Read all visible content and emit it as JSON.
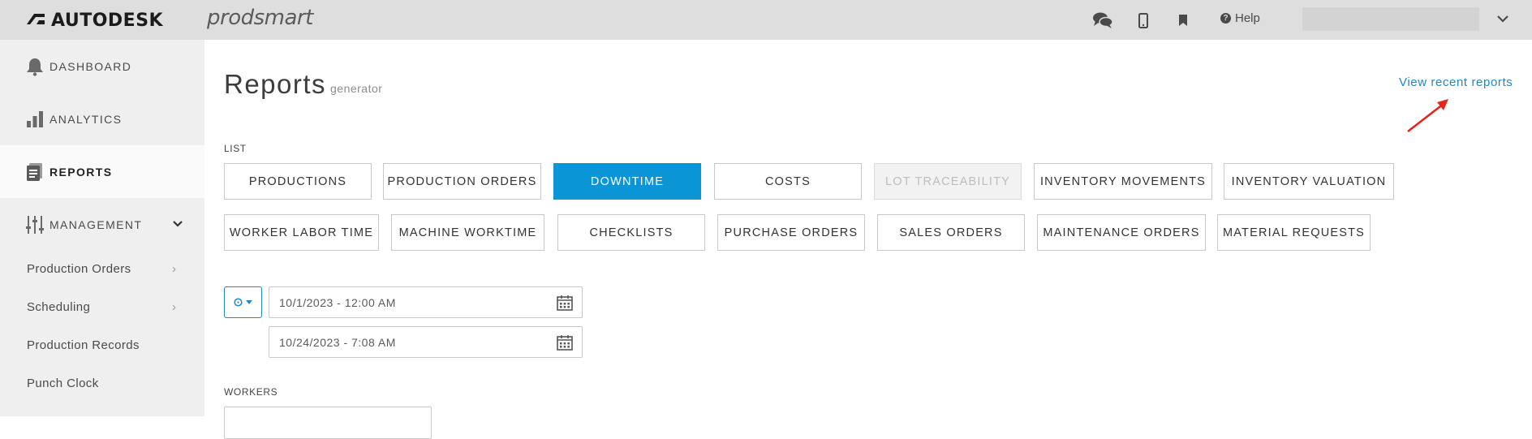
{
  "brand": {
    "name": "AUTODESK",
    "product": "prodsmart"
  },
  "topbar": {
    "help_label": "Help"
  },
  "sidebar": {
    "items": [
      {
        "label": "DASHBOARD",
        "icon": "bell-icon"
      },
      {
        "label": "ANALYTICS",
        "icon": "bar-chart-icon"
      },
      {
        "label": "REPORTS",
        "icon": "report-icon",
        "active": true
      },
      {
        "label": "MANAGEMENT",
        "icon": "sliders-icon"
      }
    ],
    "subitems": [
      {
        "label": "Production Orders"
      },
      {
        "label": "Scheduling"
      },
      {
        "label": "Production Records"
      },
      {
        "label": "Punch Clock"
      }
    ]
  },
  "main": {
    "title": "Reports",
    "subtitle": "generator",
    "recent_link": "View recent reports",
    "list_label": "LIST",
    "report_row1": [
      "PRODUCTIONS",
      "PRODUCTION ORDERS",
      "DOWNTIME",
      "COSTS",
      "LOT TRACEABILITY",
      "INVENTORY MOVEMENTS",
      "INVENTORY VALUATION"
    ],
    "report_row2": [
      "WORKER LABOR TIME",
      "MACHINE WORKTIME",
      "CHECKLISTS",
      "PURCHASE ORDERS",
      "SALES ORDERS",
      "MAINTENANCE ORDERS",
      "MATERIAL REQUESTS"
    ],
    "selected_report": "DOWNTIME",
    "disabled_report": "LOT TRACEABILITY",
    "date_from": "10/1/2023 - 12:00 AM",
    "date_to": "10/24/2023 - 7:08 AM",
    "workers_label": "WORKERS"
  },
  "colors": {
    "accent": "#0a96d6",
    "link": "#1e88c8",
    "topbar": "#dedede",
    "sidebar": "#efefef"
  }
}
